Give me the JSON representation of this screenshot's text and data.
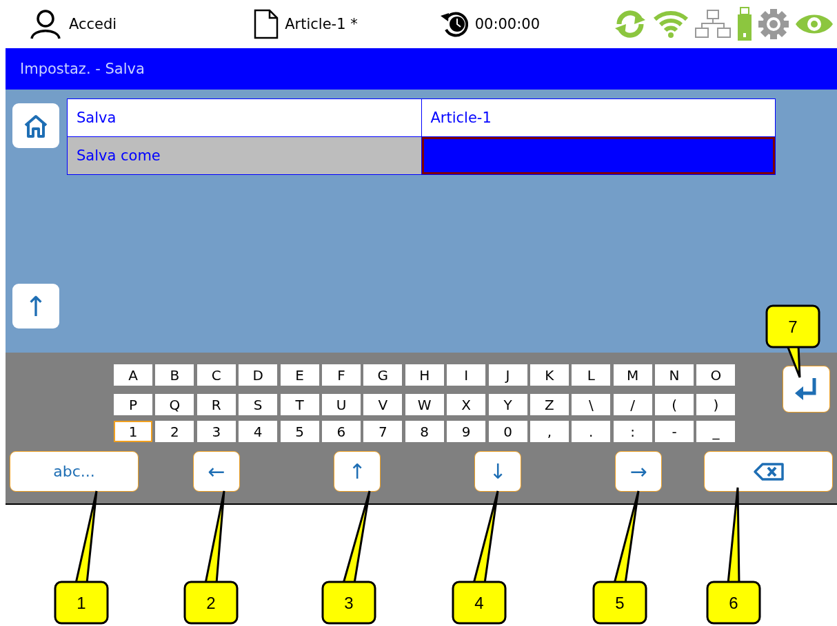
{
  "status_bar": {
    "user": "Accedi",
    "document": "Article-1 *",
    "timer": "00:00:00"
  },
  "title_bar": {
    "title": "Impostaz. - Salva"
  },
  "table": {
    "rows": [
      {
        "label": "Salva",
        "value": "Article-1",
        "selected": false
      },
      {
        "label": "Salva come",
        "selected": true
      }
    ]
  },
  "side_buttons": [
    {
      "kind": "home"
    },
    {
      "kind": "char",
      "label": "↑"
    }
  ],
  "keyboard": {
    "rows": [
      [
        {
          "label": "A",
          "selected": false
        },
        {
          "label": "B",
          "selected": false
        },
        {
          "label": "C",
          "selected": false
        },
        {
          "label": "D",
          "selected": false
        },
        {
          "label": "E",
          "selected": false
        },
        {
          "label": "F",
          "selected": false
        },
        {
          "label": "G",
          "selected": false
        },
        {
          "label": "H",
          "selected": false
        },
        {
          "label": "I",
          "selected": false
        },
        {
          "label": "J",
          "selected": false
        },
        {
          "label": "K",
          "selected": false
        },
        {
          "label": "L",
          "selected": false
        },
        {
          "label": "M",
          "selected": false
        },
        {
          "label": "N",
          "selected": false
        },
        {
          "label": "O",
          "selected": false
        }
      ],
      [
        {
          "label": "P",
          "selected": false
        },
        {
          "label": "Q",
          "selected": false
        },
        {
          "label": "R",
          "selected": false
        },
        {
          "label": "S",
          "selected": false
        },
        {
          "label": "T",
          "selected": false
        },
        {
          "label": "U",
          "selected": false
        },
        {
          "label": "V",
          "selected": false
        },
        {
          "label": "W",
          "selected": false
        },
        {
          "label": "X",
          "selected": false
        },
        {
          "label": "Y",
          "selected": false
        },
        {
          "label": "Z",
          "selected": false
        },
        {
          "label": "\\",
          "selected": false
        },
        {
          "label": "/",
          "selected": false
        },
        {
          "label": "(",
          "selected": false
        },
        {
          "label": ")",
          "selected": false
        }
      ],
      [
        {
          "label": "1",
          "selected": true
        },
        {
          "label": "2",
          "selected": false
        },
        {
          "label": "3",
          "selected": false
        },
        {
          "label": "4",
          "selected": false
        },
        {
          "label": "5",
          "selected": false
        },
        {
          "label": "6",
          "selected": false
        },
        {
          "label": "7",
          "selected": false
        },
        {
          "label": "8",
          "selected": false
        },
        {
          "label": "9",
          "selected": false
        },
        {
          "label": "0",
          "selected": false
        },
        {
          "label": ",",
          "selected": false
        },
        {
          "label": ".",
          "selected": false
        },
        {
          "label": ":",
          "selected": false
        },
        {
          "label": "-",
          "selected": false
        },
        {
          "label": "_",
          "selected": false
        }
      ]
    ],
    "buttons": [
      {
        "kind": "text",
        "label": "abc..."
      },
      {
        "kind": "char",
        "label": "←"
      },
      {
        "kind": "char",
        "label": "↑"
      },
      {
        "kind": "char",
        "label": "↓"
      },
      {
        "kind": "char",
        "label": "→"
      },
      {
        "kind": "backspace"
      }
    ]
  },
  "callouts": [
    {
      "number": "1"
    },
    {
      "number": "2"
    },
    {
      "number": "3"
    },
    {
      "number": "4"
    },
    {
      "number": "5"
    },
    {
      "number": "6"
    },
    {
      "number": "7"
    }
  ]
}
